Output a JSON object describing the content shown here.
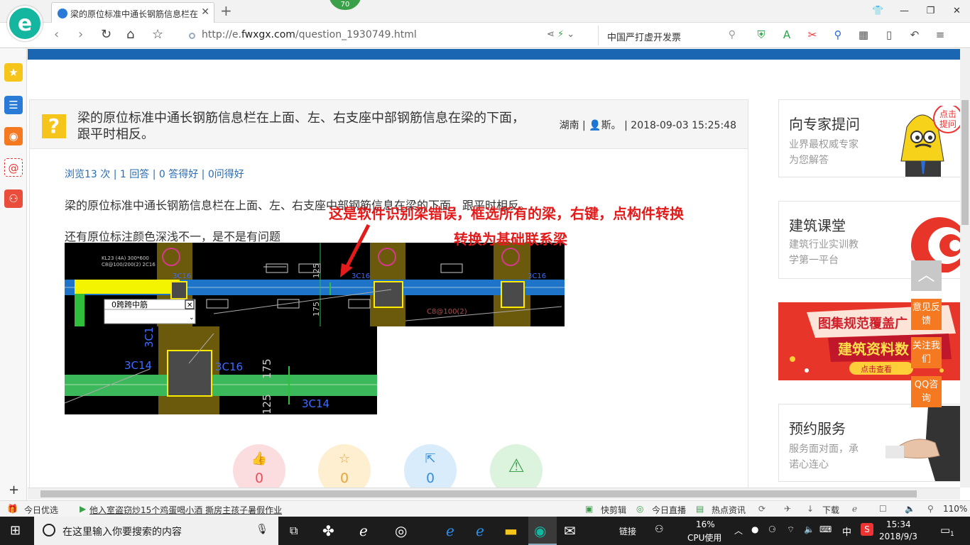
{
  "browser": {
    "tab_title": "梁的原位标准中通长钢筋信息栏在",
    "badge": "70",
    "url_prefix": "http://e.",
    "url_domain": "fwxgx.com",
    "url_path": "/question_1930749.html",
    "search_text": "中国严打虚开发票"
  },
  "question": {
    "title": "梁的原位标准中通长钢筋信息栏在上面、左、右支座中部钢筋信息在梁的下面，跟平时相反。",
    "region": "湖南",
    "user": "斯。",
    "datetime": "2018-09-03 15:25:48",
    "stats": "浏览13 次 | 1 回答 | 0 答得好 | 0问得好",
    "body_line1": "梁的原位标准中通长钢筋信息栏在上面、左、右支座中部钢筋信息在梁的下面，跟平时相反。",
    "body_line2": "还有原位标注颜色深浅不一，是不是有问题",
    "annotation1": "这是软件识别梁错误，框选所有的梁，右键，点构件转换",
    "annotation2": "转换为基础联系梁"
  },
  "cad": {
    "popup_label": "0跨跨中筋",
    "labels": [
      "3C16",
      "3C16",
      "C8@100(2)",
      "3C16",
      "125",
      "175",
      "3C14",
      "3C16",
      "175",
      "3C14",
      "125"
    ]
  },
  "reactions": [
    {
      "icon": "thumbs-up-icon",
      "glyph": "👍",
      "count": "0",
      "bg": "#fbdde0",
      "color": "#e8505b"
    },
    {
      "icon": "star-icon",
      "glyph": "☆",
      "count": "0",
      "bg": "#fdefcf",
      "color": "#e8a43a"
    },
    {
      "icon": "share-icon",
      "glyph": "⇱",
      "count": "0",
      "bg": "#d9ecfb",
      "color": "#3a8fd9"
    },
    {
      "icon": "warning-icon",
      "glyph": "⚠",
      "count": "",
      "bg": "#dcf3de",
      "color": "#3aa14a"
    }
  ],
  "right": {
    "expert_title": "向专家提问",
    "expert_sub1": "业界最权威专家",
    "expert_sub2": "为您解答",
    "expert_bubble": "点击提问",
    "class_title": "建筑课堂",
    "class_sub1": "建筑行业实训教",
    "class_sub2": "学第一平台",
    "banner_line1": "图集规范覆盖广",
    "banner_line2": "建筑资料数",
    "banner_btn": "点击查看",
    "service_title": "预约服务",
    "service_sub1": "服务面对面，承",
    "service_sub2": "诺心连心"
  },
  "float_buttons": [
    "意见反馈",
    "关注我们",
    "QQ咨询"
  ],
  "statusbar": {
    "today": "今日优选",
    "news": "他入室盗窃炒15个鸡蛋喝小酒 撕房主孩子暑假作业",
    "quickclip": "快剪辑",
    "live": "今日直播",
    "hot": "热点资讯",
    "download": "下载",
    "zoom": "110%"
  },
  "taskbar": {
    "search_placeholder": "在这里输入你要搜索的内容",
    "link": "链接",
    "cpu_pct": "16%",
    "cpu_label": "CPU使用",
    "ime": "中",
    "time": "15:34",
    "date": "2018/9/3",
    "notif": "1"
  }
}
